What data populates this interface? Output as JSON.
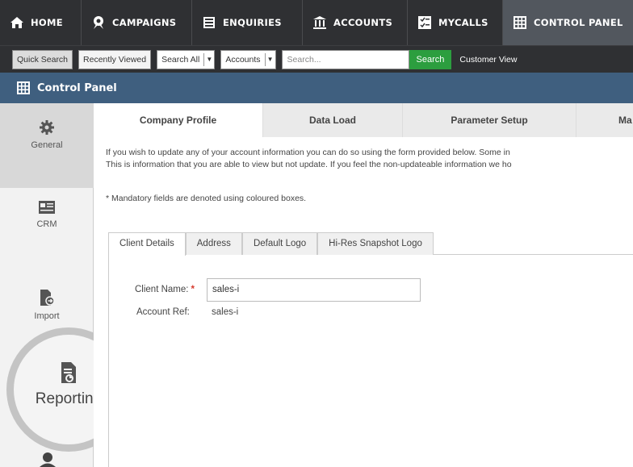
{
  "topnav": {
    "items": [
      {
        "label": "HOME",
        "icon": "home-icon"
      },
      {
        "label": "CAMPAIGNS",
        "icon": "campaigns-icon"
      },
      {
        "label": "ENQUIRIES",
        "icon": "enquiries-icon"
      },
      {
        "label": "ACCOUNTS",
        "icon": "accounts-icon"
      },
      {
        "label": "MYCALLS",
        "icon": "mycalls-icon"
      },
      {
        "label": "CONTROL PANEL",
        "icon": "control-panel-icon",
        "active": true
      }
    ]
  },
  "searchbar": {
    "quick_search": "Quick Search",
    "recently_viewed": "Recently Viewed",
    "search_all": "Search All",
    "accounts": "Accounts",
    "search_placeholder": "Search...",
    "search_button": "Search",
    "customer_view": "Customer View"
  },
  "header": {
    "title": "Control Panel"
  },
  "sidebar": {
    "items": [
      {
        "label": "General",
        "icon": "gear-icon",
        "selected": true
      },
      {
        "label": "CRM",
        "icon": "crm-icon"
      },
      {
        "label": "Import",
        "icon": "import-icon"
      },
      {
        "label": "Reporting",
        "icon": "reporting-icon",
        "highlighted": true
      }
    ]
  },
  "main": {
    "tabs": [
      {
        "label": "Company Profile",
        "active": true
      },
      {
        "label": "Data Load"
      },
      {
        "label": "Parameter Setup"
      },
      {
        "label": "Ma"
      }
    ],
    "intro_line1": "If you wish to update any of your account information you can do so using the form provided below. Some in",
    "intro_line2": "This is information that you are able to view but not update. If you feel the non-updateable information we ho",
    "mandatory_note": "* Mandatory fields are denoted using coloured boxes.",
    "subtabs": [
      {
        "label": "Client Details",
        "active": true
      },
      {
        "label": "Address"
      },
      {
        "label": "Default Logo"
      },
      {
        "label": "Hi-Res Snapshot Logo"
      }
    ],
    "form": {
      "client_name_label": "Client Name:",
      "required_marker": "*",
      "client_name_value": "sales-i",
      "account_ref_label": "Account Ref:",
      "account_ref_value": "sales-i"
    }
  },
  "colors": {
    "topnav_bg": "#2f3033",
    "header_bg": "#3f5f7f",
    "search_button_bg": "#2c9e3f",
    "required_color": "#d63a2d"
  }
}
